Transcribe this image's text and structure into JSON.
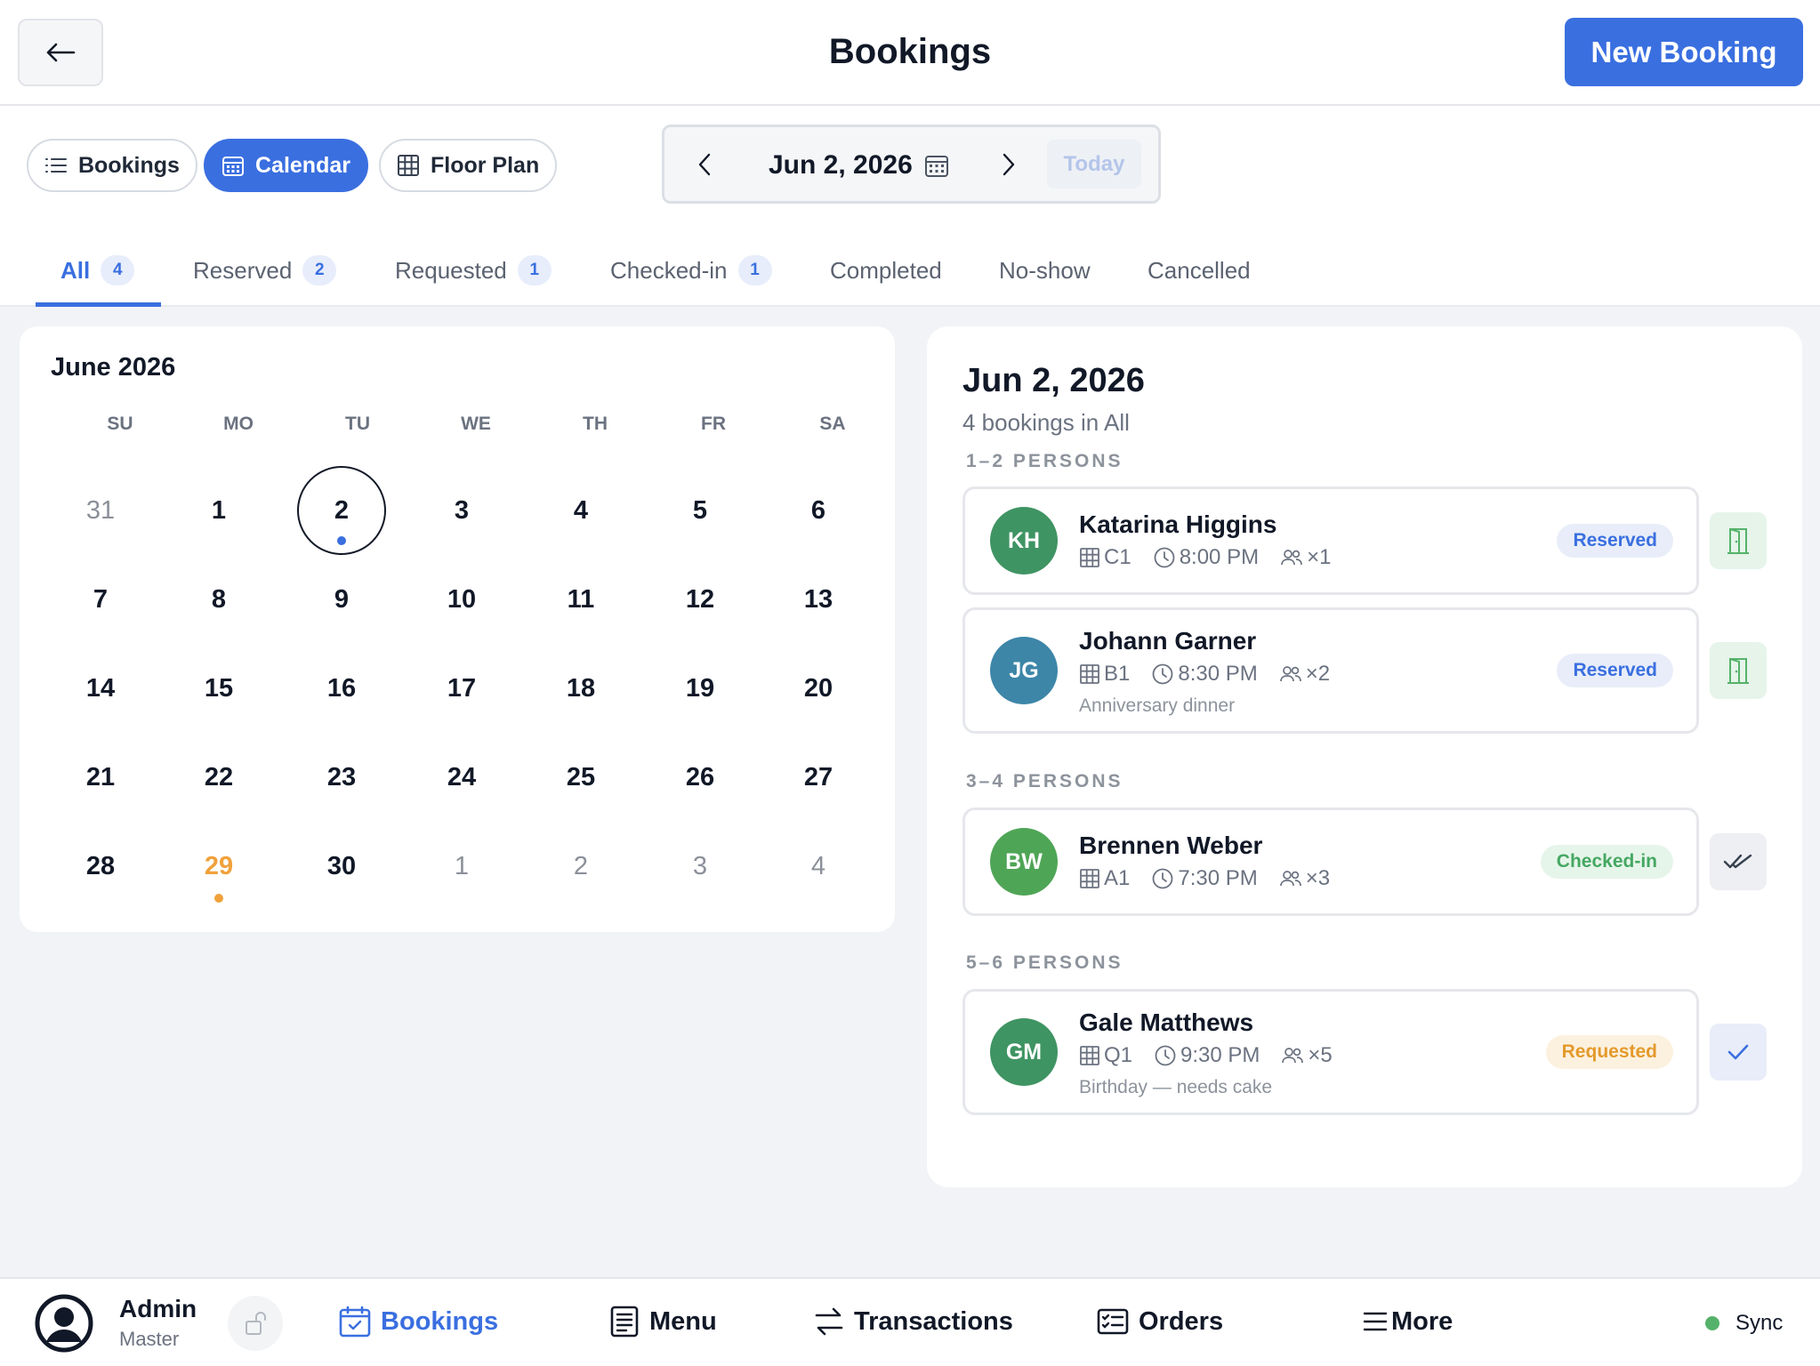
{
  "header": {
    "title": "Bookings",
    "new_booking_label": "New Booking"
  },
  "views": [
    {
      "label": "Bookings",
      "icon": "list-icon",
      "active": false
    },
    {
      "label": "Calendar",
      "icon": "calendar-icon",
      "active": true
    },
    {
      "label": "Floor Plan",
      "icon": "grid-icon",
      "active": false
    }
  ],
  "date_nav": {
    "date": "Jun 2, 2026",
    "today_label": "Today"
  },
  "status_tabs": [
    {
      "label": "All",
      "count": "4",
      "active": true
    },
    {
      "label": "Reserved",
      "count": "2"
    },
    {
      "label": "Requested",
      "count": "1"
    },
    {
      "label": "Checked-in",
      "count": "1"
    },
    {
      "label": "Completed"
    },
    {
      "label": "No-show"
    },
    {
      "label": "Cancelled"
    }
  ],
  "calendar": {
    "month_label": "June 2026",
    "weekdays": [
      "SU",
      "MO",
      "TU",
      "WE",
      "TH",
      "FR",
      "SA"
    ],
    "weeks": [
      [
        {
          "d": "31",
          "muted": true
        },
        {
          "d": "1"
        },
        {
          "d": "2",
          "selected": true,
          "dot": "#3a6fe0"
        },
        {
          "d": "3"
        },
        {
          "d": "4"
        },
        {
          "d": "5"
        },
        {
          "d": "6"
        }
      ],
      [
        {
          "d": "7"
        },
        {
          "d": "8"
        },
        {
          "d": "9"
        },
        {
          "d": "10"
        },
        {
          "d": "11"
        },
        {
          "d": "12"
        },
        {
          "d": "13"
        }
      ],
      [
        {
          "d": "14"
        },
        {
          "d": "15"
        },
        {
          "d": "16"
        },
        {
          "d": "17"
        },
        {
          "d": "18"
        },
        {
          "d": "19"
        },
        {
          "d": "20"
        }
      ],
      [
        {
          "d": "21"
        },
        {
          "d": "22"
        },
        {
          "d": "23"
        },
        {
          "d": "24"
        },
        {
          "d": "25"
        },
        {
          "d": "26"
        },
        {
          "d": "27"
        }
      ],
      [
        {
          "d": "28"
        },
        {
          "d": "29",
          "warn": true,
          "dot": "#f0a13b"
        },
        {
          "d": "30"
        },
        {
          "d": "1",
          "muted": true
        },
        {
          "d": "2",
          "muted": true
        },
        {
          "d": "3",
          "muted": true
        },
        {
          "d": "4",
          "muted": true
        }
      ]
    ]
  },
  "panel": {
    "date": "Jun 2, 2026",
    "subtitle": "4 bookings in All",
    "groups": [
      {
        "label": "1–2 PERSONS"
      },
      {
        "label": "3–4 PERSONS"
      },
      {
        "label": "5–6 PERSONS"
      }
    ],
    "bookings": [
      {
        "initials": "KH",
        "avatar_color": "#3f9463",
        "name": "Katarina Higgins",
        "table": "C1",
        "time": "8:00 PM",
        "party": "×1",
        "note": "",
        "status": "Reserved",
        "status_color": "#3a6fe0",
        "status_bg": "#e8edf9",
        "action": "door-icon",
        "action_color": "#55b26a",
        "action_bg": "#e6f4ea"
      },
      {
        "initials": "JG",
        "avatar_color": "#3d86a8",
        "name": "Johann Garner",
        "table": "B1",
        "time": "8:30 PM",
        "party": "×2",
        "note": "Anniversary dinner",
        "status": "Reserved",
        "status_color": "#3a6fe0",
        "status_bg": "#e8edf9",
        "action": "door-icon",
        "action_color": "#55b26a",
        "action_bg": "#e6f4ea"
      },
      {
        "initials": "BW",
        "avatar_color": "#4fa556",
        "name": "Brennen Weber",
        "table": "A1",
        "time": "7:30 PM",
        "party": "×3",
        "note": "",
        "status": "Checked-in",
        "status_color": "#45a862",
        "status_bg": "#e6f5ea",
        "action": "double-check-icon",
        "action_color": "#374151",
        "action_bg": "#eeeff2"
      },
      {
        "initials": "GM",
        "avatar_color": "#3f9463",
        "name": "Gale Matthews",
        "table": "Q1",
        "time": "9:30 PM",
        "party": "×5",
        "note": "Birthday — needs cake",
        "status": "Requested",
        "status_color": "#e49a2c",
        "status_bg": "#fcf1df",
        "action": "check-icon",
        "action_color": "#3a6fe0",
        "action_bg": "#e8edf9"
      }
    ]
  },
  "bottom_nav": {
    "user": {
      "name": "Admin",
      "role": "Master"
    },
    "items": [
      {
        "label": "Bookings",
        "icon": "calendar-check-icon",
        "active": true
      },
      {
        "label": "Menu",
        "icon": "menu-book-icon"
      },
      {
        "label": "Transactions",
        "icon": "transfer-icon"
      },
      {
        "label": "Orders",
        "icon": "orders-icon"
      },
      {
        "label": "More",
        "icon": "hamburger-icon"
      }
    ],
    "sync_label": "Sync",
    "sync_color": "#55b26a"
  }
}
